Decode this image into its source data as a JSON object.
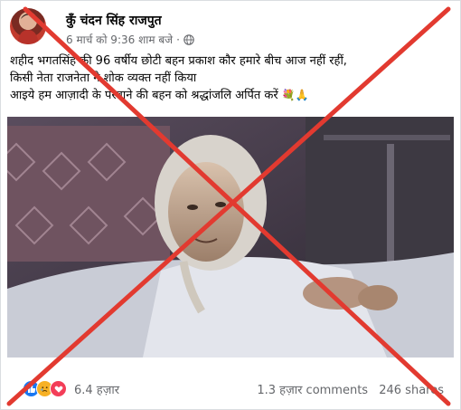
{
  "post": {
    "author": "कुँ चंदन सिंह राजपुत",
    "timestamp": "6 मार्च को 9:36 शाम बजे",
    "separator": "·",
    "text_lines": [
      "शहीद भगतसिंह  की 96 वर्षीय  छोटी बहन प्रकाश कौर हमारे बीच आज नहीं रहीं,",
      "किसी नेता राजनेता ने शोक व्यक्त नहीं किया",
      "आइये हम आज़ादी के परवाने की बहन को श्रद्धांजलि अर्पित करें "
    ],
    "text_emojis": "💐🙏"
  },
  "footer": {
    "reaction_count": "6.4 हज़ार",
    "comments": "1.3 हज़ार comments",
    "shares": "246 shares"
  },
  "icons": {
    "reactions": [
      "like-icon",
      "sad-icon",
      "love-icon"
    ],
    "privacy": "globe-icon"
  },
  "colors": {
    "overlay_x": "#e23a30",
    "like": "#1877f2",
    "sad": "#f7b125",
    "love": "#f33e58",
    "secondary_text": "#65676b"
  }
}
